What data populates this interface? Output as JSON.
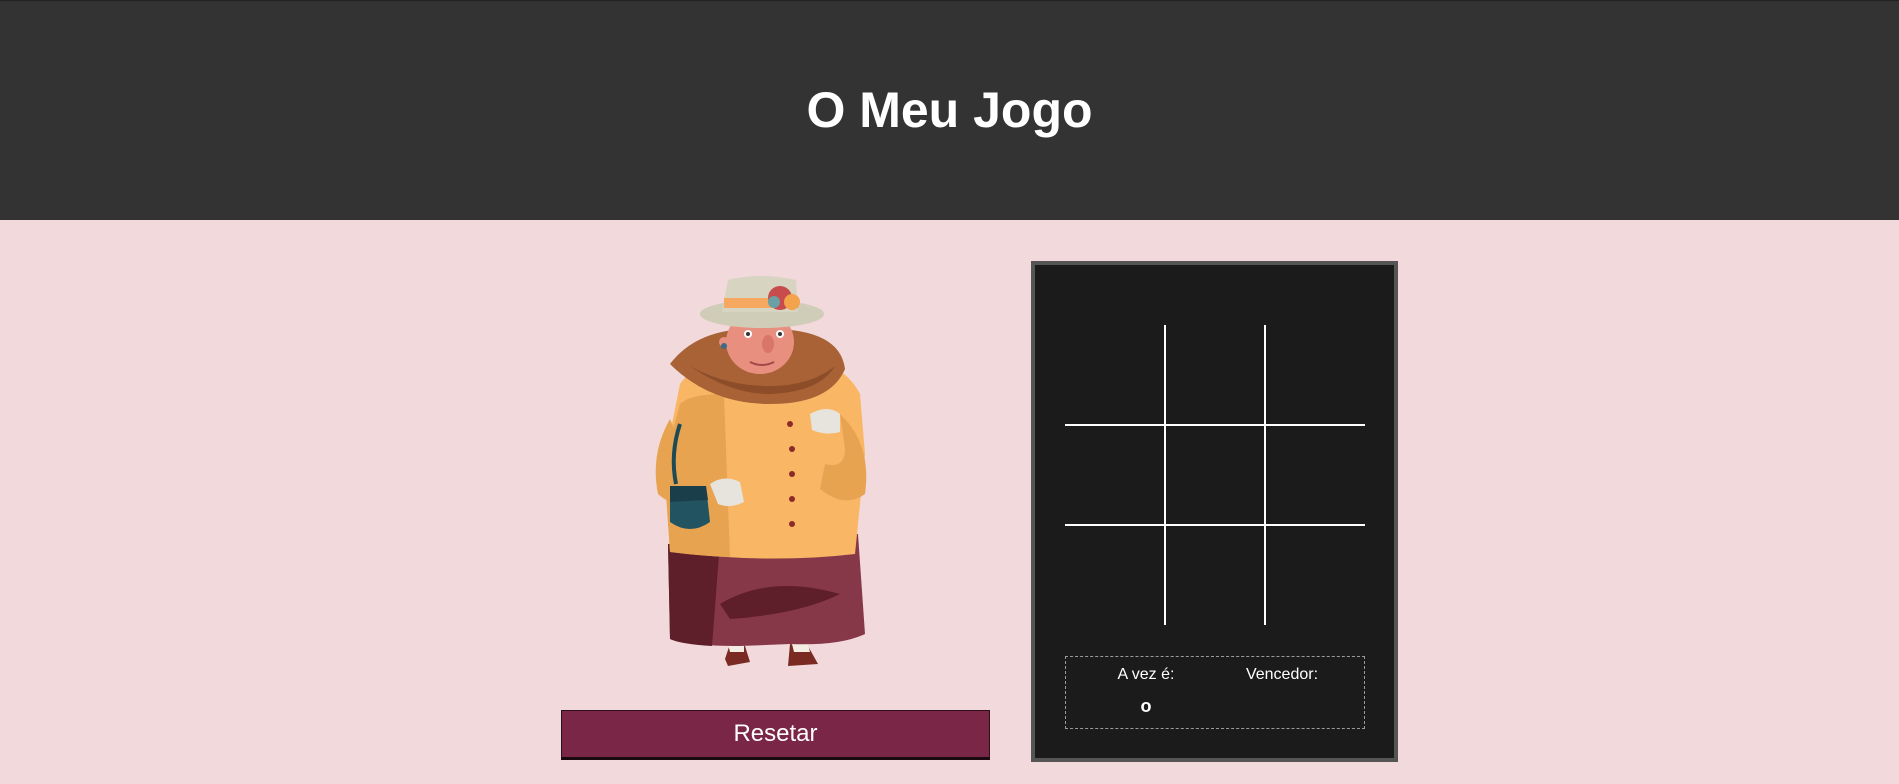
{
  "header": {
    "title": "O Meu Jogo"
  },
  "illustration": {
    "icon": "grandma-character-illustration"
  },
  "controls": {
    "reset_label": "Resetar"
  },
  "board": {
    "cells": [
      "",
      "",
      "",
      "",
      "",
      "",
      "",
      "",
      ""
    ]
  },
  "status": {
    "turn_label": "A vez é:",
    "turn_value": "o",
    "winner_label": "Vencedor:",
    "winner_value": ""
  },
  "colors": {
    "header_bg": "#333333",
    "page_bg": "#f1d9dc",
    "panel_bg": "#1b1b1b",
    "button_bg": "#7a2646"
  }
}
